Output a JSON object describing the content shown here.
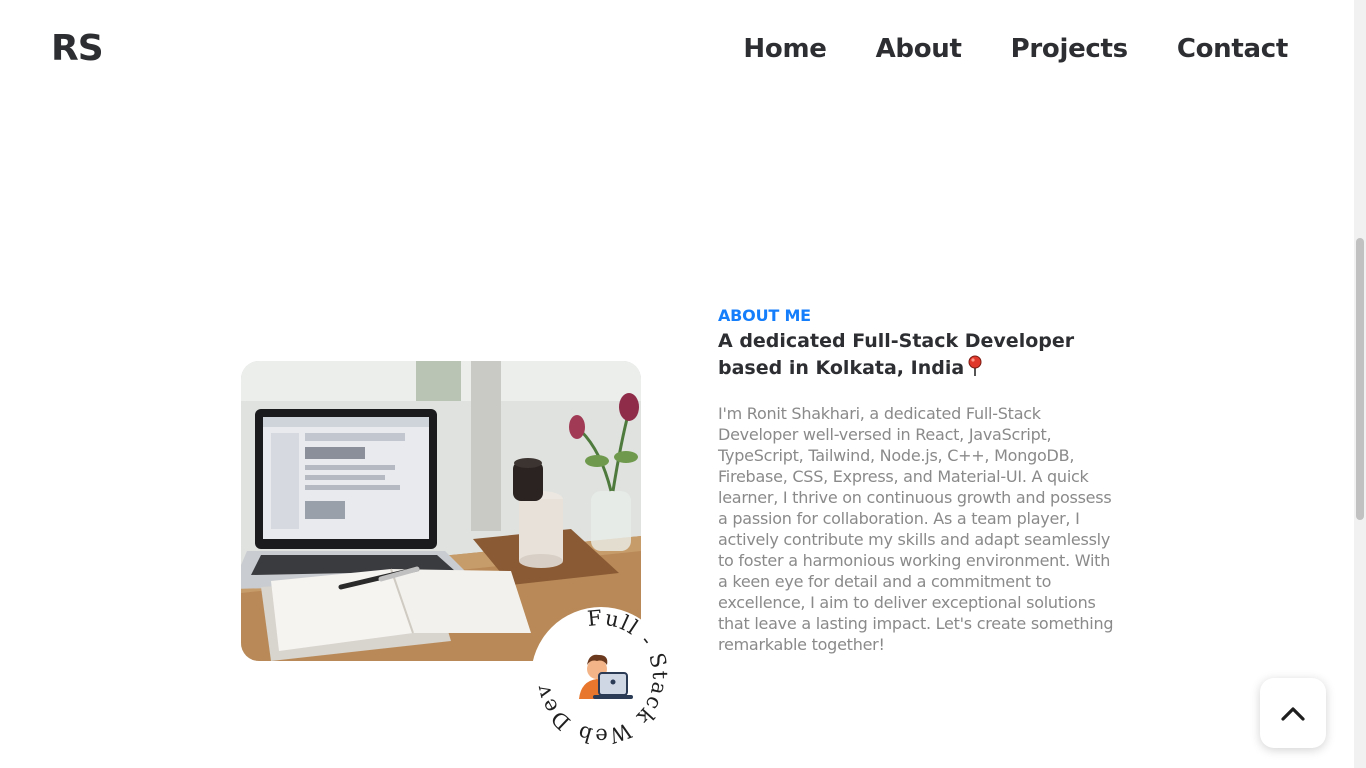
{
  "header": {
    "logo": "RS",
    "nav": [
      {
        "label": "Home"
      },
      {
        "label": "About"
      },
      {
        "label": "Projects"
      },
      {
        "label": "Contact"
      }
    ]
  },
  "about": {
    "eyebrow": "ABOUT ME",
    "headline": "A dedicated Full-Stack Developer based in Kolkata, India",
    "bio": "I'm Ronit Shakhari, a dedicated Full-Stack Developer well-versed in React, JavaScript, TypeScript, Tailwind, Node.js, C++, MongoDB, Firebase, CSS, Express, and Material-UI. A quick learner, I thrive on continuous growth and possess a passion for collaboration. As a team player, I actively contribute my skills and adapt seamlessly to foster a harmonious working environment. With a keen eye for detail and a commitment to excellence, I aim to deliver exceptional solutions that leave a lasting impact. Let's create something remarkable together!",
    "badge_text": "Full - Stack Web Developer"
  },
  "icons": {
    "location": "round-pushpin-icon",
    "back_to_top": "chevron-up-icon",
    "developer": "developer-at-laptop-icon"
  },
  "colors": {
    "accent": "#147efb",
    "heading": "#2d2e32",
    "body_text": "#8a8a8a",
    "pin": "#e0392b"
  }
}
